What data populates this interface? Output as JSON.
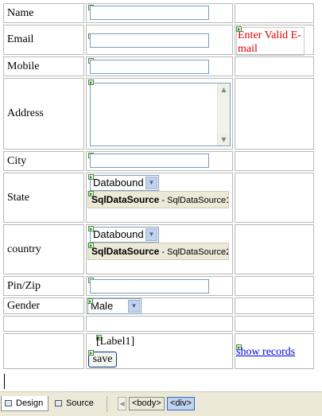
{
  "form": {
    "name_label": "Name",
    "email_label": "Email",
    "email_error": "Enter Valid E-mail",
    "mobile_label": "Mobile",
    "address_label": "Address",
    "city_label": "City",
    "state_label": "State",
    "state_dropdown_value": "Databound",
    "state_datasource": {
      "type": "SqlDataSource",
      "id": " - SqlDataSource1"
    },
    "country_label": "country",
    "country_dropdown_value": "Databound",
    "country_datasource": {
      "type": "SqlDataSource",
      "id": " - SqlDataSource2"
    },
    "pin_label": "Pin/Zip",
    "gender_label": "Gender",
    "gender_value": "Male",
    "label_control": "[Label1]",
    "save_label": "save",
    "show_records_label": "show records"
  },
  "statusbar": {
    "design_tab": "Design",
    "source_tab": "Source",
    "crumbs": [
      "<body>",
      "<div>"
    ]
  }
}
